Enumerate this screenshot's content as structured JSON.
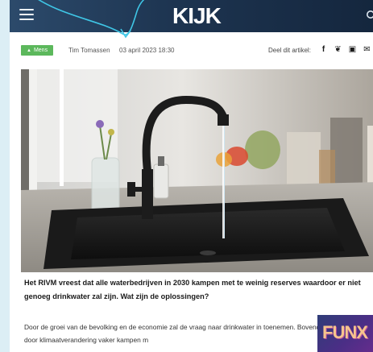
{
  "header": {
    "logo_text": "KIJK",
    "menu_icon": "hamburger-icon",
    "search_icon": "search-icon",
    "colors": {
      "bar": "#1d3450",
      "accent_swoop": "#3fc6e6"
    }
  },
  "meta": {
    "badge_label": "Mens",
    "author": "Tim Tomassen",
    "date": "03 april 2023 18:30",
    "share_label": "Deel dit artikel:",
    "share_icons": [
      "facebook-icon",
      "twitter-icon",
      "whatsapp-icon",
      "email-icon"
    ],
    "share_glyphs": [
      "f",
      "❦",
      "▣",
      "✉"
    ],
    "badge_color": "#5cb85c"
  },
  "hero": {
    "subject": "kitchen-sink-photo"
  },
  "article": {
    "lead": "Het RIVM vreest dat alle waterbedrijven in 2030 kampen met te weinig reserves waardoor er niet genoeg drinkwater zal zijn. Wat zijn de oplossingen?",
    "body": "Door de groei van de bevolking en de economie zal de vraag naar drinkwater in toenemen. Bovendien zal Nederland door klimaatverandering vaker kampen m"
  },
  "ad": {
    "text": "FUNX"
  }
}
